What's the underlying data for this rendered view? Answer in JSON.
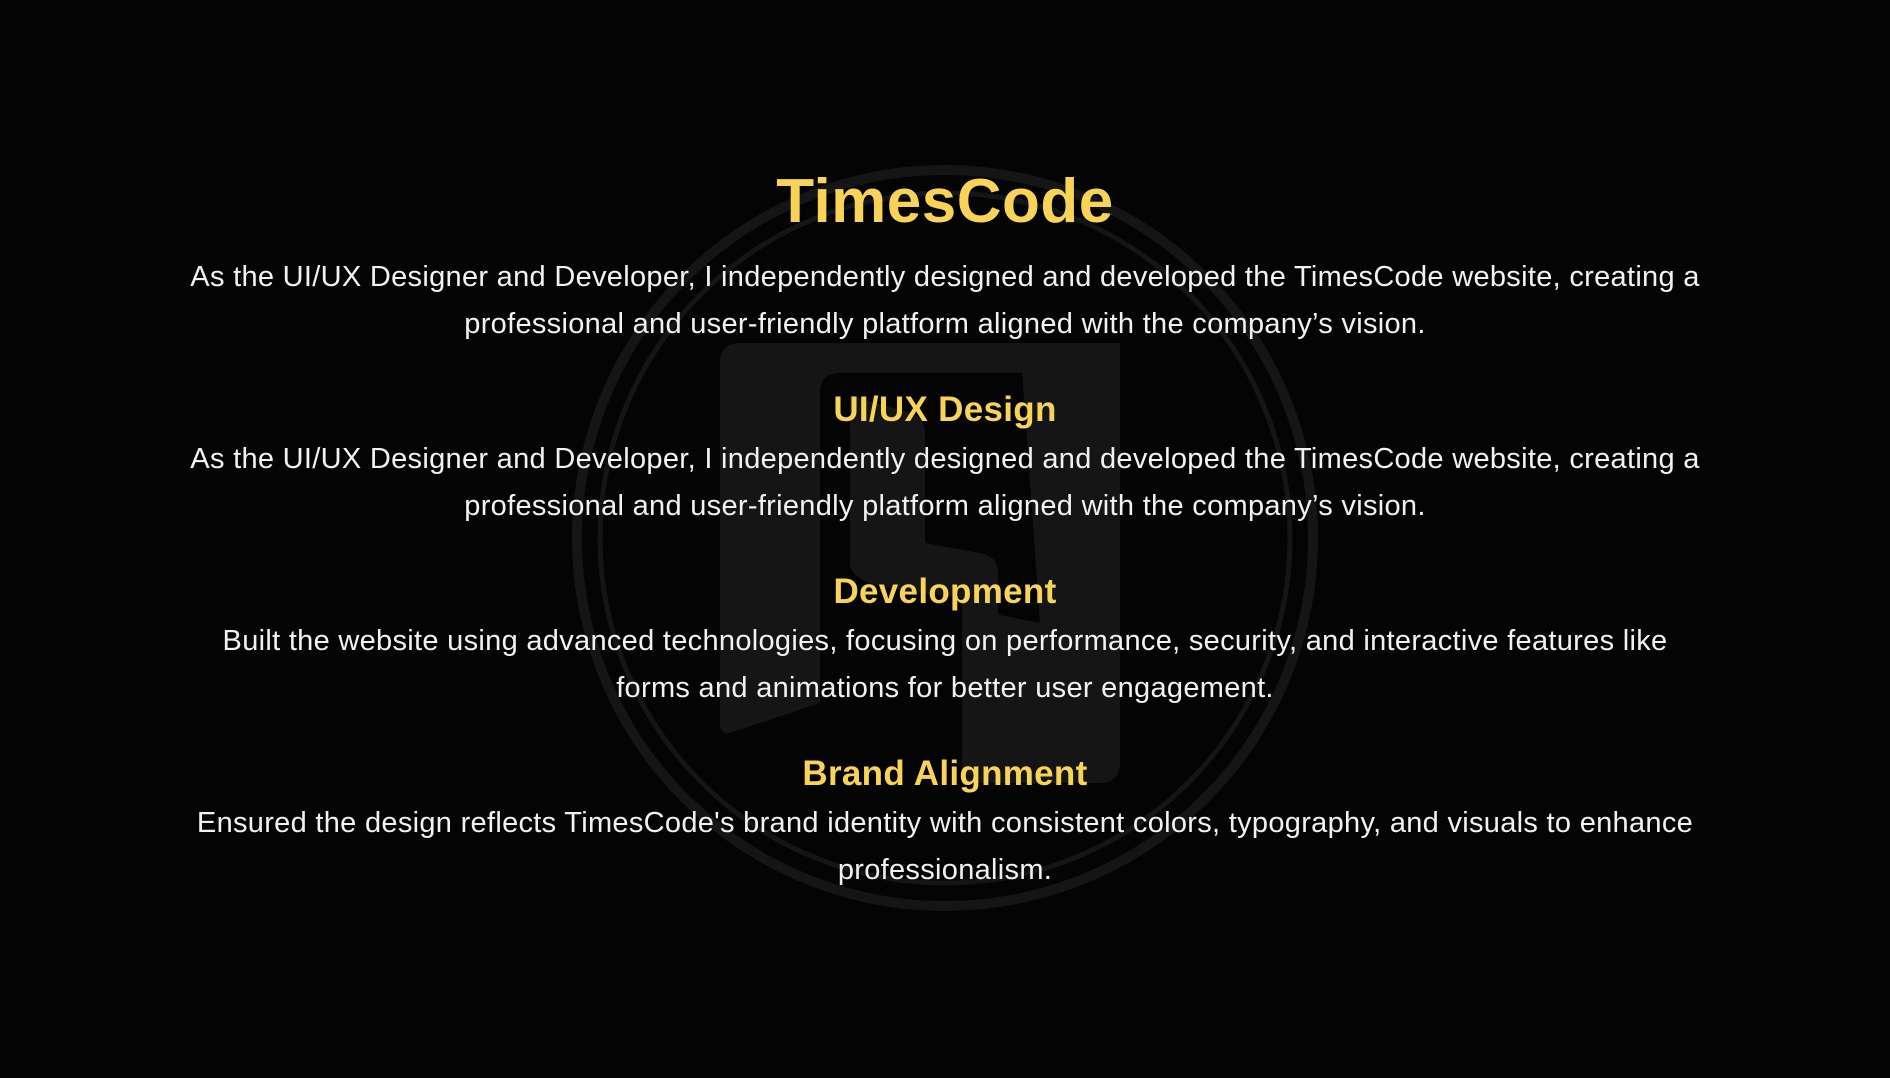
{
  "theme": {
    "background": "#040404",
    "accent": "#f7d358",
    "text": "#f2f2f2",
    "watermark": "#151515"
  },
  "header": {
    "title": "TimesCode",
    "intro": "As the UI/UX Designer and Developer, I independently designed and developed the TimesCode website, creating a professional and user-friendly platform aligned with the company’s vision."
  },
  "watermark": {
    "icon": "timescode-logo-icon"
  },
  "sections": [
    {
      "title": "UI/UX Design",
      "body": "As the UI/UX Designer and Developer, I independently designed and developed the TimesCode website, creating a professional and user-friendly platform aligned with the company’s vision."
    },
    {
      "title": "Development",
      "body": "Built the website using advanced technologies, focusing on performance, security, and interactive features like forms and animations for better user engagement."
    },
    {
      "title": "Brand Alignment",
      "body": "Ensured the design reflects TimesCode's brand identity with consistent colors, typography, and visuals to enhance professionalism."
    }
  ]
}
